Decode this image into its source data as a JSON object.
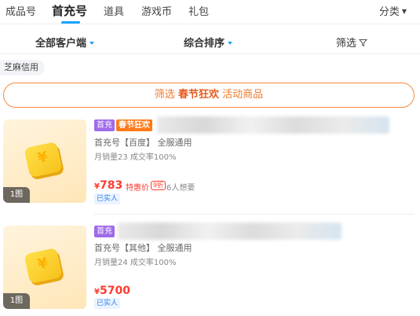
{
  "tabs": [
    {
      "label": "成品号"
    },
    {
      "label": "首充号"
    },
    {
      "label": "道具"
    },
    {
      "label": "游戏币"
    },
    {
      "label": "礼包"
    }
  ],
  "category_label": "分类",
  "filters": {
    "client": "全部客户端",
    "sort": "综合排序",
    "screen": "筛选"
  },
  "chip": "芝麻信用",
  "banner": {
    "prefix": "筛选 ",
    "highlight": "春节狂欢",
    "suffix": " 活动商品"
  },
  "listings": [
    {
      "tags": [
        "首充",
        "春节狂欢"
      ],
      "subtitle": "首充号【百度】 全服通用",
      "sales": "月销量23 成交率100%",
      "currency": "¥",
      "price": "783",
      "special": "特惠价",
      "discount": "9折",
      "wants": "6人想要",
      "verified": "已实人",
      "pic_count": "1图",
      "coin_glyph": "¥"
    },
    {
      "tags": [
        "首充"
      ],
      "subtitle": "首充号【其他】 全服通用",
      "sales": "月销量24 成交率100%",
      "currency": "¥",
      "price": "5700",
      "verified": "已实人",
      "pic_count": "1图",
      "coin_glyph": "¥"
    }
  ],
  "colors": {
    "accent_blue": "#1aa3ff",
    "banner_orange": "#f07a2a",
    "price_red": "#ff3b30",
    "tag_purple": "#9f6ae8",
    "tag_orange": "#ff7a18"
  },
  "icons": [
    "chevron-down-icon",
    "funnel-icon",
    "yuan-coin-icon",
    "watermark-logo-icon"
  ]
}
